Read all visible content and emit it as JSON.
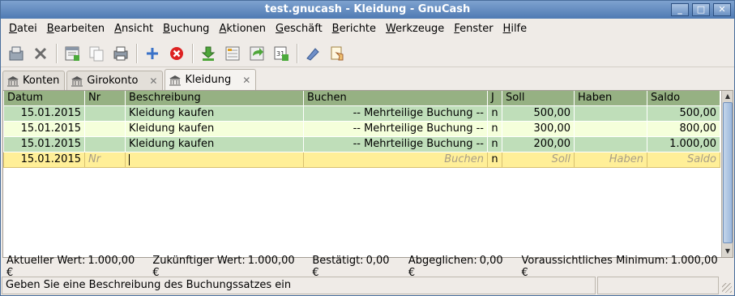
{
  "window": {
    "title": "test.gnucash - Kleidung - GnuCash"
  },
  "menu": [
    {
      "label": "Datei",
      "name": "menu-datei"
    },
    {
      "label": "Bearbeiten",
      "name": "menu-bearbeiten"
    },
    {
      "label": "Ansicht",
      "name": "menu-ansicht"
    },
    {
      "label": "Buchung",
      "name": "menu-buchung"
    },
    {
      "label": "Aktionen",
      "name": "menu-aktionen"
    },
    {
      "label": "Geschäft",
      "name": "menu-geschaeft"
    },
    {
      "label": "Berichte",
      "name": "menu-berichte"
    },
    {
      "label": "Werkzeuge",
      "name": "menu-werkzeuge"
    },
    {
      "label": "Fenster",
      "name": "menu-fenster"
    },
    {
      "label": "Hilfe",
      "name": "menu-hilfe"
    }
  ],
  "tabs": [
    {
      "label": "Konten",
      "closable": false
    },
    {
      "label": "Girokonto",
      "closable": true
    },
    {
      "label": "Kleidung",
      "closable": true,
      "active": true
    }
  ],
  "register": {
    "columns": [
      "Datum",
      "Nr",
      "Beschreibung",
      "Buchen",
      "J",
      "Soll",
      "Haben",
      "Saldo"
    ],
    "rows": [
      {
        "datum": "15.01.2015",
        "nr": "",
        "beschreibung": "Kleidung kaufen",
        "buchen": "-- Mehrteilige Buchung --",
        "j": "n",
        "soll": "500,00",
        "haben": "",
        "saldo": "500,00"
      },
      {
        "datum": "15.01.2015",
        "nr": "",
        "beschreibung": "Kleidung kaufen",
        "buchen": "-- Mehrteilige Buchung --",
        "j": "n",
        "soll": "300,00",
        "haben": "",
        "saldo": "800,00"
      },
      {
        "datum": "15.01.2015",
        "nr": "",
        "beschreibung": "Kleidung kaufen",
        "buchen": "-- Mehrteilige Buchung --",
        "j": "n",
        "soll": "200,00",
        "haben": "",
        "saldo": "1.000,00"
      }
    ],
    "blank_row": {
      "datum": "15.01.2015",
      "nr_placeholder": "Nr",
      "buchen_placeholder": "Buchen",
      "j": "n",
      "soll_placeholder": "Soll",
      "haben_placeholder": "Haben",
      "saldo_placeholder": "Saldo"
    }
  },
  "summary": [
    {
      "label": "Aktueller Wert:",
      "value": "1.000,00 €"
    },
    {
      "label": "Zukünftiger Wert:",
      "value": "1.000,00 €"
    },
    {
      "label": "Bestätigt:",
      "value": "0,00 €"
    },
    {
      "label": "Abgeglichen:",
      "value": "0,00 €"
    },
    {
      "label": "Voraussichtliches Minimum:",
      "value": "1.000,00 €"
    }
  ],
  "status": {
    "text": "Geben Sie eine Beschreibung des Buchungssatzes ein"
  },
  "toolbar_icons": [
    "save-icon",
    "close-icon",
    "new-invoice-icon",
    "duplicate-icon",
    "print-icon",
    "add-icon",
    "delete-icon",
    "import-icon",
    "split-icon",
    "jump-icon",
    "schedule-icon",
    "transfer-icon",
    "reconcile-icon"
  ]
}
